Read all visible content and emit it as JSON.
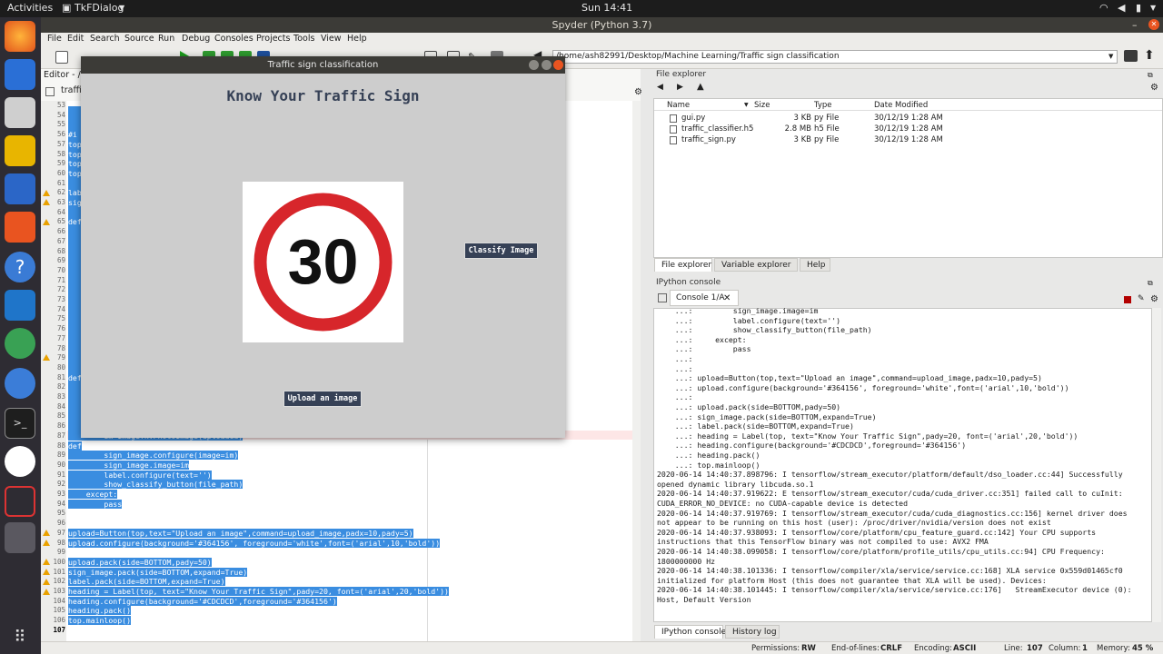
{
  "topbar": {
    "activities": "Activities",
    "app": "TkFDialog",
    "clock": "Sun 14:41"
  },
  "window": {
    "title": "Spyder (Python 3.7)"
  },
  "menu": [
    "File",
    "Edit",
    "Search",
    "Source",
    "Run",
    "Debug",
    "Consoles",
    "Projects",
    "Tools",
    "View",
    "Help"
  ],
  "path": "/home/ash82991/Desktop/Machine Learning/Traffic sign classification",
  "editor": {
    "title": "Editor - /he",
    "tab": "traffi"
  },
  "line_numbers": [
    "53",
    "54",
    "55",
    "56",
    "57",
    "58",
    "59",
    "60",
    "61",
    "62",
    "63",
    "64",
    "65",
    "66",
    "67",
    "68",
    "69",
    "70",
    "71",
    "72",
    "73",
    "74",
    "75",
    "76",
    "77",
    "78",
    "79",
    "80",
    "81",
    "82",
    "83",
    "84",
    "85",
    "86",
    "87",
    "88",
    "89",
    "90",
    "91",
    "92",
    "93",
    "94",
    "95",
    "96",
    "97",
    "98",
    "99",
    "100",
    "101",
    "102",
    "103",
    "104",
    "105",
    "106",
    "107"
  ],
  "code_visible": [
    {
      "line": "87",
      "text": "        im=ImageTk.PhotoImage(uploaded)"
    },
    {
      "line": "89",
      "text": "        sign_image.configure(image=im)"
    },
    {
      "line": "90",
      "text": "        sign_image.image=im"
    },
    {
      "line": "91",
      "text": "        label.configure(text='')"
    },
    {
      "line": "92",
      "text": "        show_classify_button(file_path)"
    },
    {
      "line": "93",
      "text": "    except:"
    },
    {
      "line": "94",
      "text": "        pass"
    },
    {
      "line": "97",
      "text": "upload=Button(top,text=\"Upload an image\",command=upload_image,padx=10,pady=5)"
    },
    {
      "line": "98",
      "text": "upload.configure(background='#364156', foreground='white',font=('arial',10,'bold'))"
    },
    {
      "line": "100",
      "text": "upload.pack(side=BOTTOM,pady=50)"
    },
    {
      "line": "101",
      "text": "sign_image.pack(side=BOTTOM,expand=True)"
    },
    {
      "line": "102",
      "text": "label.pack(side=BOTTOM,expand=True)"
    },
    {
      "line": "103",
      "text": "heading = Label(top, text=\"Know Your Traffic Sign\",pady=20, font=('arial',20,'bold'))"
    },
    {
      "line": "104",
      "text": "heading.configure(background='#CDCDCD',foreground='#364156')"
    },
    {
      "line": "105",
      "text": "heading.pack()"
    },
    {
      "line": "106",
      "text": "top.mainloop()"
    }
  ],
  "code_fragments": [
    "#i",
    "top",
    "top",
    "top",
    "top",
    "lab",
    "sig",
    "def",
    "def",
    "def"
  ],
  "file_explorer": {
    "title": "File explorer",
    "columns": [
      "Name",
      "Size",
      "Type",
      "Date Modified"
    ],
    "rows": [
      {
        "name": "gui.py",
        "size": "3 KB",
        "type": "py File",
        "date": "30/12/19 1:28 AM"
      },
      {
        "name": "traffic_classifier.h5",
        "size": "2.8 MB",
        "type": "h5 File",
        "date": "30/12/19 1:28 AM"
      },
      {
        "name": "traffic_sign.py",
        "size": "3 KB",
        "type": "py File",
        "date": "30/12/19 1:28 AM"
      }
    ],
    "tabs": [
      "File explorer",
      "Variable explorer",
      "Help"
    ]
  },
  "ipython": {
    "title": "IPython console",
    "tab": "Console 1/A",
    "bottom_tabs": [
      "IPython console",
      "History log"
    ]
  },
  "console_lines": [
    "    ...:         sign_image.image=im",
    "    ...:         label.configure(text='')",
    "    ...:         show_classify_button(file_path)",
    "    ...:     except:",
    "    ...:         pass",
    "    ...:",
    "    ...:",
    "    ...: upload=Button(top,text=\"Upload an image\",command=upload_image,padx=10,pady=5)",
    "    ...: upload.configure(background='#364156', foreground='white',font=('arial',10,'bold'))",
    "    ...:",
    "    ...: upload.pack(side=BOTTOM,pady=50)",
    "    ...: sign_image.pack(side=BOTTOM,expand=True)",
    "    ...: label.pack(side=BOTTOM,expand=True)",
    "    ...: heading = Label(top, text=\"Know Your Traffic Sign\",pady=20, font=('arial',20,'bold'))",
    "    ...: heading.configure(background='#CDCDCD',foreground='#364156')",
    "    ...: heading.pack()",
    "    ...: top.mainloop()",
    "2020-06-14 14:40:37.898796: I tensorflow/stream_executor/platform/default/dso_loader.cc:44] Successfully",
    "opened dynamic library libcuda.so.1",
    "2020-06-14 14:40:37.919622: E tensorflow/stream_executor/cuda/cuda_driver.cc:351] failed call to cuInit:",
    "CUDA_ERROR_NO_DEVICE: no CUDA-capable device is detected",
    "2020-06-14 14:40:37.919769: I tensorflow/stream_executor/cuda/cuda_diagnostics.cc:156] kernel driver does",
    "not appear to be running on this host (user): /proc/driver/nvidia/version does not exist",
    "2020-06-14 14:40:37.938093: I tensorflow/core/platform/cpu_feature_guard.cc:142] Your CPU supports",
    "instructions that this TensorFlow binary was not compiled to use: AVX2 FMA",
    "2020-06-14 14:40:38.099058: I tensorflow/core/platform/profile_utils/cpu_utils.cc:94] CPU Frequency:",
    "1800000000 Hz",
    "2020-06-14 14:40:38.101336: I tensorflow/compiler/xla/service/service.cc:168] XLA service 0x559d01465cf0",
    "initialized for platform Host (this does not guarantee that XLA will be used). Devices:",
    "2020-06-14 14:40:38.101445: I tensorflow/compiler/xla/service/service.cc:176]   StreamExecutor device (0):",
    "Host, Default Version"
  ],
  "status": {
    "perm_label": "Permissions:",
    "perm": "RW",
    "eol_label": "End-of-lines:",
    "eol": "CRLF",
    "enc_label": "Encoding:",
    "enc": "ASCII",
    "line_label": "Line:",
    "line": "107",
    "col_label": "Column:",
    "col": "1",
    "mem_label": "Memory:",
    "mem": "45 %"
  },
  "dialog": {
    "title": "Traffic sign classification",
    "heading": "Know Your Traffic Sign",
    "sign_text": "30",
    "classify": "Classify Image",
    "upload": "Upload an image"
  },
  "colors": {
    "tk_bg": "#CDCDCD",
    "tk_fg": "#364156",
    "selection": "#3a8de0",
    "sign_red": "#d7262b"
  }
}
